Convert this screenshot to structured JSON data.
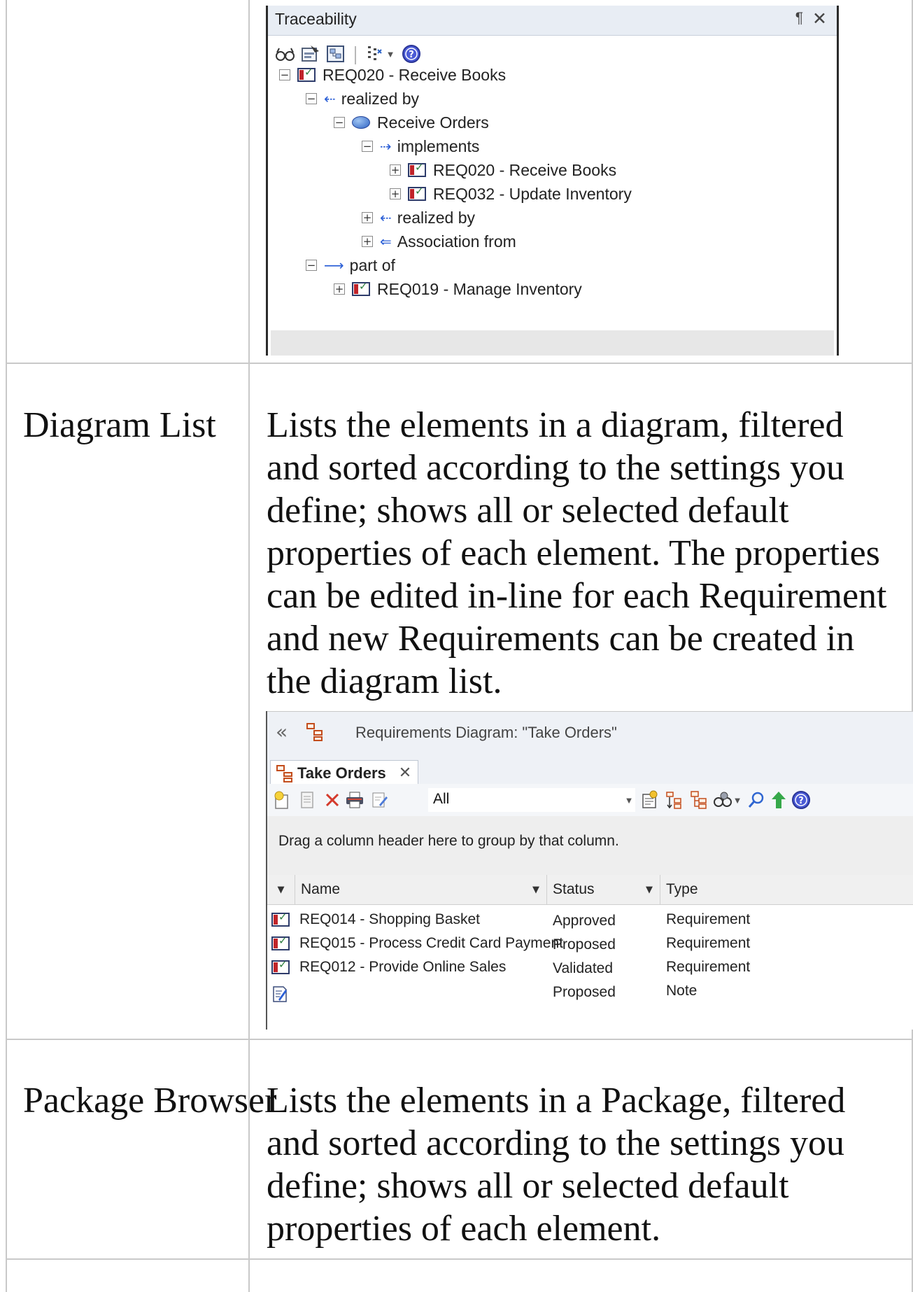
{
  "traceability": {
    "title": "Traceability",
    "pin_glyph": "¶",
    "close_glyph": "✕",
    "tree": [
      {
        "label": "REQ020 - Receive Books",
        "icon": "requirement-icon",
        "expander": "−"
      },
      {
        "label": "realized by",
        "icon": "realization-arrow-icon",
        "expander": "−"
      },
      {
        "label": "Receive Orders",
        "icon": "use-case-icon",
        "expander": "−"
      },
      {
        "label": "implements",
        "icon": "implements-arrow-icon",
        "expander": "−"
      },
      {
        "label": "REQ020 - Receive Books",
        "icon": "requirement-icon",
        "expander": "+"
      },
      {
        "label": "REQ032 - Update Inventory",
        "icon": "requirement-icon",
        "expander": "+"
      },
      {
        "label": "realized by",
        "icon": "realization-arrow-icon",
        "expander": "+"
      },
      {
        "label": "Association from",
        "icon": "association-arrow-icon",
        "expander": "+"
      },
      {
        "label": "part of",
        "icon": "aggregation-arrow-icon",
        "expander": "−"
      },
      {
        "label": "REQ019 - Manage Inventory",
        "icon": "requirement-icon",
        "expander": "+"
      }
    ]
  },
  "rows": [
    {
      "feature": "Diagram List",
      "description": "Lists the elements in a diagram, filtered and sorted according to the settings you define; shows all or selected default properties of each element. The properties can be edited in-line for each Requirement and new Requirements can be created in the diagram list."
    },
    {
      "feature": "Package Browser",
      "description": "Lists the elements in a Package, filtered and sorted according to the settings you define; shows all or selected default properties of each element."
    }
  ],
  "diagram_list": {
    "header_title": "Requirements Diagram: \"Take Orders\"",
    "collapse_glyph": "«",
    "tab_label": "Take Orders",
    "tab_close": "✕",
    "filter_value": "All",
    "group_hint": "Drag a column header here to group by that column.",
    "columns": [
      "Name",
      "Status",
      "Type"
    ],
    "items": [
      {
        "name": "REQ014 - Shopping Basket",
        "status": "Approved",
        "type": "Requirement",
        "icon": "requirement-icon"
      },
      {
        "name": "REQ015 - Process Credit Card Payment",
        "status": "Proposed",
        "type": "Requirement",
        "icon": "requirement-icon"
      },
      {
        "name": "REQ012 - Provide Online Sales",
        "status": "Validated",
        "type": "Requirement",
        "icon": "requirement-icon"
      },
      {
        "name": "",
        "status": "Proposed",
        "type": "Note",
        "icon": "note-icon"
      }
    ]
  }
}
